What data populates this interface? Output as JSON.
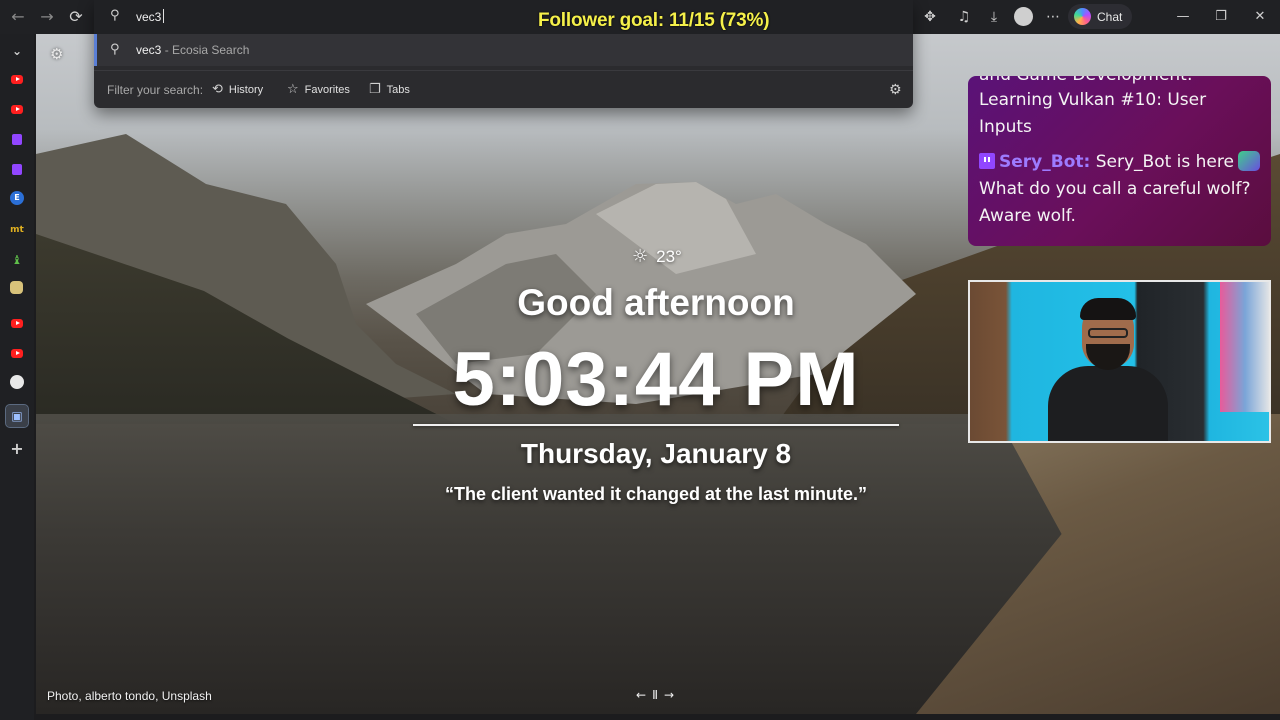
{
  "browser": {
    "address_text": "vec3",
    "suggestion": {
      "query": "vec3",
      "source": " - Ecosia Search"
    },
    "filter": {
      "label": "Filter your search:",
      "chips": [
        "History",
        "Favorites",
        "Tabs"
      ]
    },
    "chat_button": "Chat"
  },
  "overlay": {
    "follower_goal": "Follower goal: 11/15 (73%)"
  },
  "newtab": {
    "temperature": "23°",
    "greeting": "Good afternoon",
    "time": "5:03:44 PM",
    "date": "Thursday, January 8",
    "quote": "“The client wanted it changed at the last minute.”",
    "photo_credit": "Photo, alberto tondo, Unsplash"
  },
  "chat": {
    "partial_top": "and Game Development:",
    "line1": "Learning Vulkan #10: User",
    "line2": "Inputs",
    "bot_user": "Sery_Bot",
    "bot_sep": ":",
    "bot_msg1": " Sery_Bot is here",
    "bot_msg2": "What do you call a careful wolf?",
    "bot_msg3": "Aware wolf."
  },
  "icons": {
    "back": "←",
    "forward": "→",
    "refresh": "⟳",
    "search": "⚲",
    "gear": "⚙",
    "download": "⤓",
    "more": "⋯",
    "sun": "☼",
    "prev": "←",
    "next": "→",
    "pause": "Ⅱ",
    "plus": "+"
  },
  "colors": {
    "goal_yellow": "#f5f04a",
    "twitch_purple": "#9146ff",
    "youtube_red": "#ff1f1f"
  }
}
